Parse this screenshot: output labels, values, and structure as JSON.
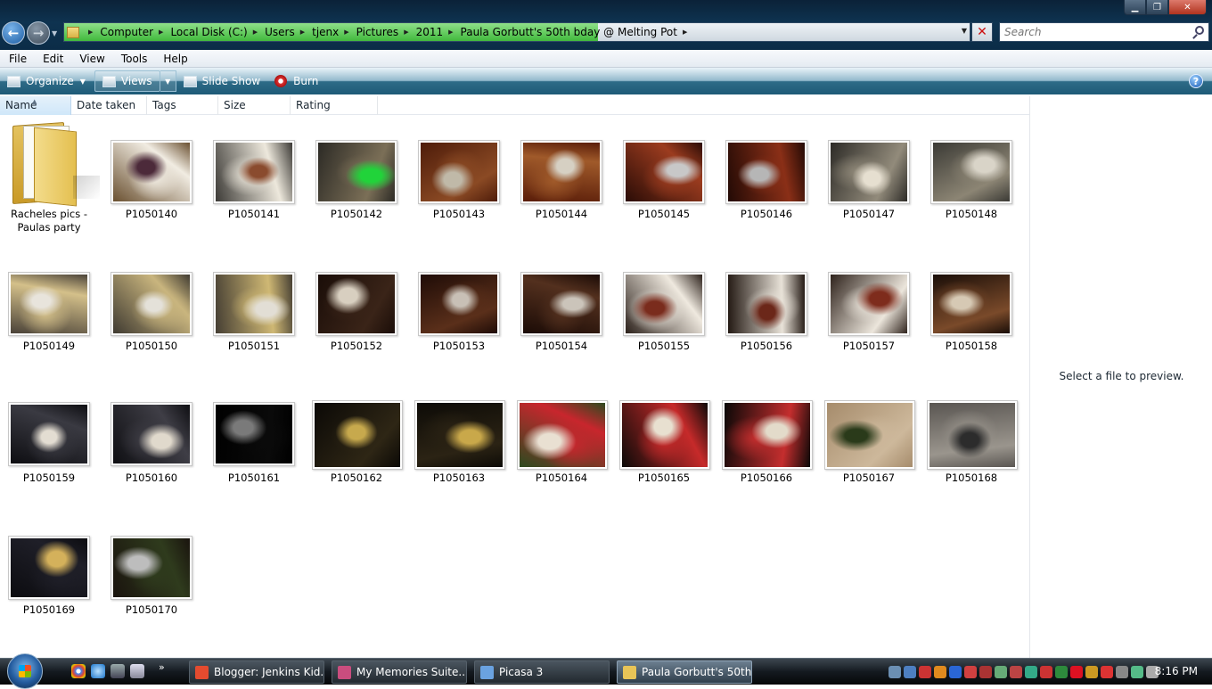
{
  "window": {
    "controls": {
      "minimize": "▁",
      "maximize": "❐",
      "close": "✕"
    }
  },
  "address_bar": {
    "breadcrumbs": [
      "Computer",
      "Local Disk (C:)",
      "Users",
      "tjenx",
      "Pictures",
      "2011",
      "Paula Gorbutt's 50th bday @ Melting Pot"
    ],
    "load_progress": 0.59,
    "progress_color": "#41b93c"
  },
  "search": {
    "placeholder": "Search"
  },
  "menu": [
    "File",
    "Edit",
    "View",
    "Tools",
    "Help"
  ],
  "toolbar": {
    "organize": "Organize",
    "views": "Views",
    "slideshow": "Slide Show",
    "burn": "Burn",
    "help": "?"
  },
  "columns": [
    "Name",
    "Date taken",
    "Tags",
    "Size",
    "Rating"
  ],
  "items": [
    {
      "label": "Racheles pics - Paulas party",
      "type": "folder"
    },
    {
      "label": "P1050140",
      "colors": [
        "#6a5030",
        "#f1ece2",
        "#4c2a3a"
      ]
    },
    {
      "label": "P1050141",
      "colors": [
        "#3c3a36",
        "#ede8dc",
        "#8a4b2e"
      ]
    },
    {
      "label": "P1050142",
      "colors": [
        "#2c2a25",
        "#7b6f57",
        "#21d33a"
      ]
    },
    {
      "label": "P1050143",
      "colors": [
        "#4e1c0a",
        "#8b4a24",
        "#c0b9a8"
      ]
    },
    {
      "label": "P1050144",
      "colors": [
        "#5a1d09",
        "#a05a2a",
        "#d6d0c3"
      ]
    },
    {
      "label": "P1050145",
      "colors": [
        "#2a0c06",
        "#9c3c1f",
        "#c8c8c8"
      ]
    },
    {
      "label": "P1050146",
      "colors": [
        "#230a05",
        "#8a2f17",
        "#b6b6b6"
      ]
    },
    {
      "label": "P1050147",
      "colors": [
        "#2d2b27",
        "#928b7b",
        "#e6dfd0"
      ]
    },
    {
      "label": "P1050148",
      "colors": [
        "#3b3a35",
        "#8c8574",
        "#d9d4c8"
      ]
    },
    {
      "label": "P1050149",
      "colors": [
        "#4a4238",
        "#d4c08a",
        "#e8e4dc"
      ]
    },
    {
      "label": "P1050150",
      "colors": [
        "#3f3a31",
        "#c9b57e",
        "#e4e1d9"
      ]
    },
    {
      "label": "P1050151",
      "colors": [
        "#453e33",
        "#cfb874",
        "#e2ded5"
      ]
    },
    {
      "label": "P1050152",
      "colors": [
        "#1a0d08",
        "#3a2418",
        "#d8cfc0"
      ]
    },
    {
      "label": "P1050153",
      "colors": [
        "#1f0c07",
        "#5a2f1a",
        "#c8c0b6"
      ]
    },
    {
      "label": "P1050154",
      "colors": [
        "#1b0b06",
        "#53301e",
        "#cbc4ba"
      ]
    },
    {
      "label": "P1050155",
      "colors": [
        "#2c211b",
        "#efe9df",
        "#7a2c1d"
      ]
    },
    {
      "label": "P1050156",
      "colors": [
        "#231913",
        "#e8e2d8",
        "#6b2719"
      ]
    },
    {
      "label": "P1050157",
      "colors": [
        "#2f231c",
        "#ece6dc",
        "#7e2c1c"
      ]
    },
    {
      "label": "P1050158",
      "colors": [
        "#1a0e08",
        "#7a4a2a",
        "#d6c9b4"
      ]
    },
    {
      "label": "P1050159",
      "colors": [
        "#0e0e12",
        "#3a3a42",
        "#e3ddd2"
      ]
    },
    {
      "label": "P1050160",
      "colors": [
        "#0f0f13",
        "#3f3e46",
        "#e0d9cc"
      ]
    },
    {
      "label": "P1050161",
      "colors": [
        "#000000",
        "#0a0a0a",
        "#7a7a7a"
      ]
    },
    {
      "label": "P1050162",
      "colors": [
        "#0b0906",
        "#2e2615",
        "#c7a94d"
      ]
    },
    {
      "label": "P1050163",
      "colors": [
        "#0d0b07",
        "#2b2314",
        "#c9a84a"
      ]
    },
    {
      "label": "P1050164",
      "colors": [
        "#2c4a1f",
        "#c8262d",
        "#e9e0d2"
      ]
    },
    {
      "label": "P1050165",
      "colors": [
        "#0c0a08",
        "#c62a2a",
        "#e8e0d0"
      ]
    },
    {
      "label": "P1050166",
      "colors": [
        "#0a0807",
        "#c42e2e",
        "#e3dbca"
      ]
    },
    {
      "label": "P1050167",
      "colors": [
        "#a68c6c",
        "#cdb89b",
        "#2a3a1a"
      ]
    },
    {
      "label": "P1050168",
      "colors": [
        "#5a5652",
        "#9a958d",
        "#2c2c2c"
      ]
    },
    {
      "label": "P1050169",
      "colors": [
        "#0c0c10",
        "#1f1f28",
        "#d4b15b"
      ]
    },
    {
      "label": "P1050170",
      "colors": [
        "#1a140e",
        "#2f3b1d",
        "#bdbdbd"
      ]
    }
  ],
  "preview": {
    "message": "Select a file to preview."
  },
  "taskbar": {
    "tasks": [
      {
        "label": "Blogger: Jenkins Kid...",
        "icon_color": "#e44b2f"
      },
      {
        "label": "My Memories Suite...",
        "icon_color": "#c94d7e"
      },
      {
        "label": "Picasa 3",
        "icon_color": "#6aa2e0"
      },
      {
        "label": "Paula Gorbutt's 50th...",
        "icon_color": "#e8c457"
      }
    ],
    "clock": "8:16 PM",
    "quicklaunch_more": "»"
  }
}
